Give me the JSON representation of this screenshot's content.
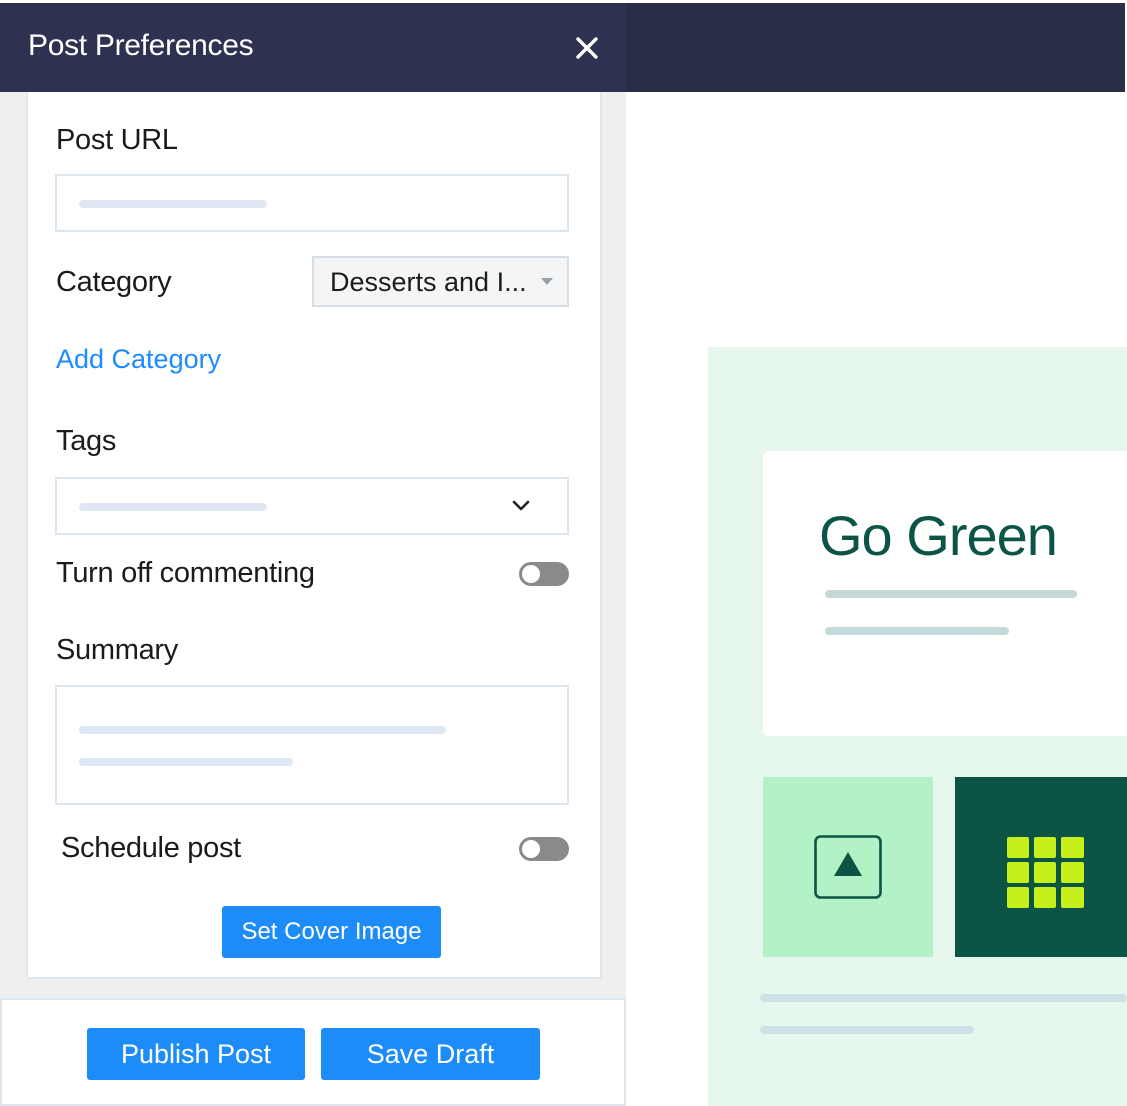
{
  "header": {
    "title": "Post Preferences",
    "close_icon": "close-icon"
  },
  "form": {
    "post_url": {
      "label": "Post URL",
      "value": ""
    },
    "category": {
      "label": "Category",
      "selected": "Desserts and I..."
    },
    "add_category_label": "Add Category",
    "tags": {
      "label": "Tags",
      "value": ""
    },
    "turn_off_commenting": {
      "label": "Turn off commenting",
      "enabled": false
    },
    "summary": {
      "label": "Summary",
      "value": ""
    },
    "schedule_post": {
      "label": "Schedule post",
      "enabled": false
    },
    "set_cover_image_label": "Set Cover Image"
  },
  "footer": {
    "publish_label": "Publish Post",
    "save_draft_label": "Save Draft"
  },
  "preview": {
    "title": "Go Green",
    "image_icon": "mountain-image-icon",
    "grid_icon": "grid-icon"
  },
  "colors": {
    "header_bg": "#2d3251",
    "accent_blue": "#1d8cf8",
    "link_blue": "#1a8cff",
    "preview_green": "#0b5446",
    "preview_light_green": "#b3f1c6",
    "grid_lime": "#c5f01c"
  }
}
